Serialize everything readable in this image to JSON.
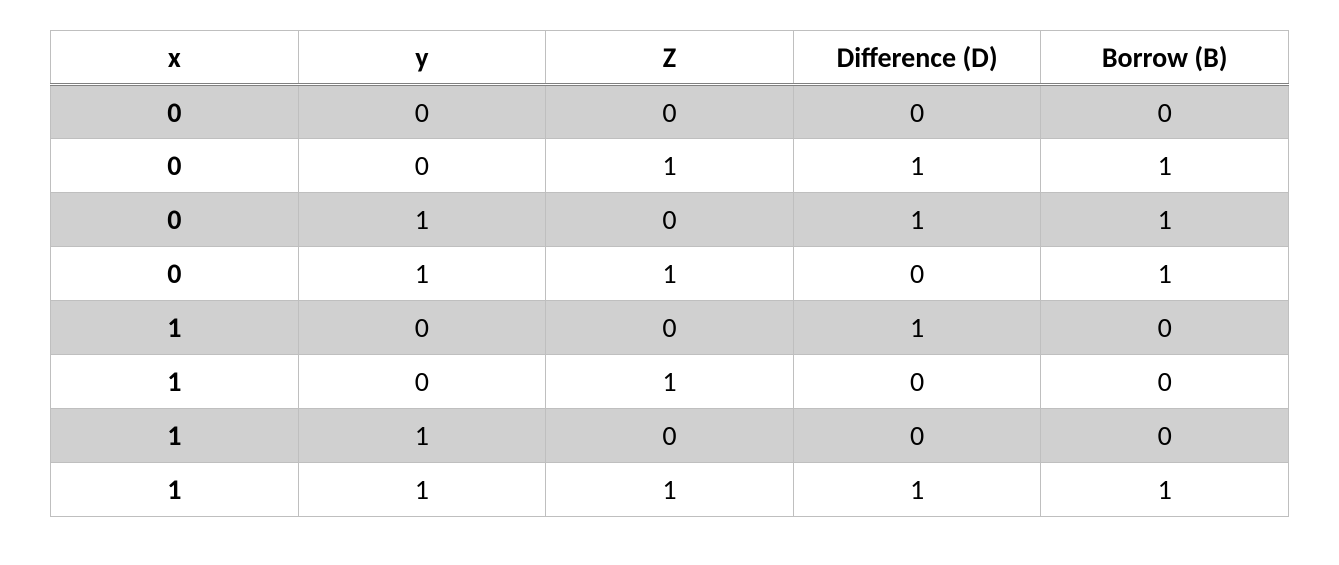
{
  "chart_data": {
    "type": "table",
    "columns": [
      "x",
      "y",
      "Z",
      "Difference (D)",
      "Borrow (B)"
    ],
    "rows": [
      [
        "0",
        "0",
        "0",
        "0",
        "0"
      ],
      [
        "0",
        "0",
        "1",
        "1",
        "1"
      ],
      [
        "0",
        "1",
        "0",
        "1",
        "1"
      ],
      [
        "0",
        "1",
        "1",
        "0",
        "1"
      ],
      [
        "1",
        "0",
        "0",
        "1",
        "0"
      ],
      [
        "1",
        "0",
        "1",
        "0",
        "0"
      ],
      [
        "1",
        "1",
        "0",
        "0",
        "0"
      ],
      [
        "1",
        "1",
        "1",
        "1",
        "1"
      ]
    ]
  }
}
